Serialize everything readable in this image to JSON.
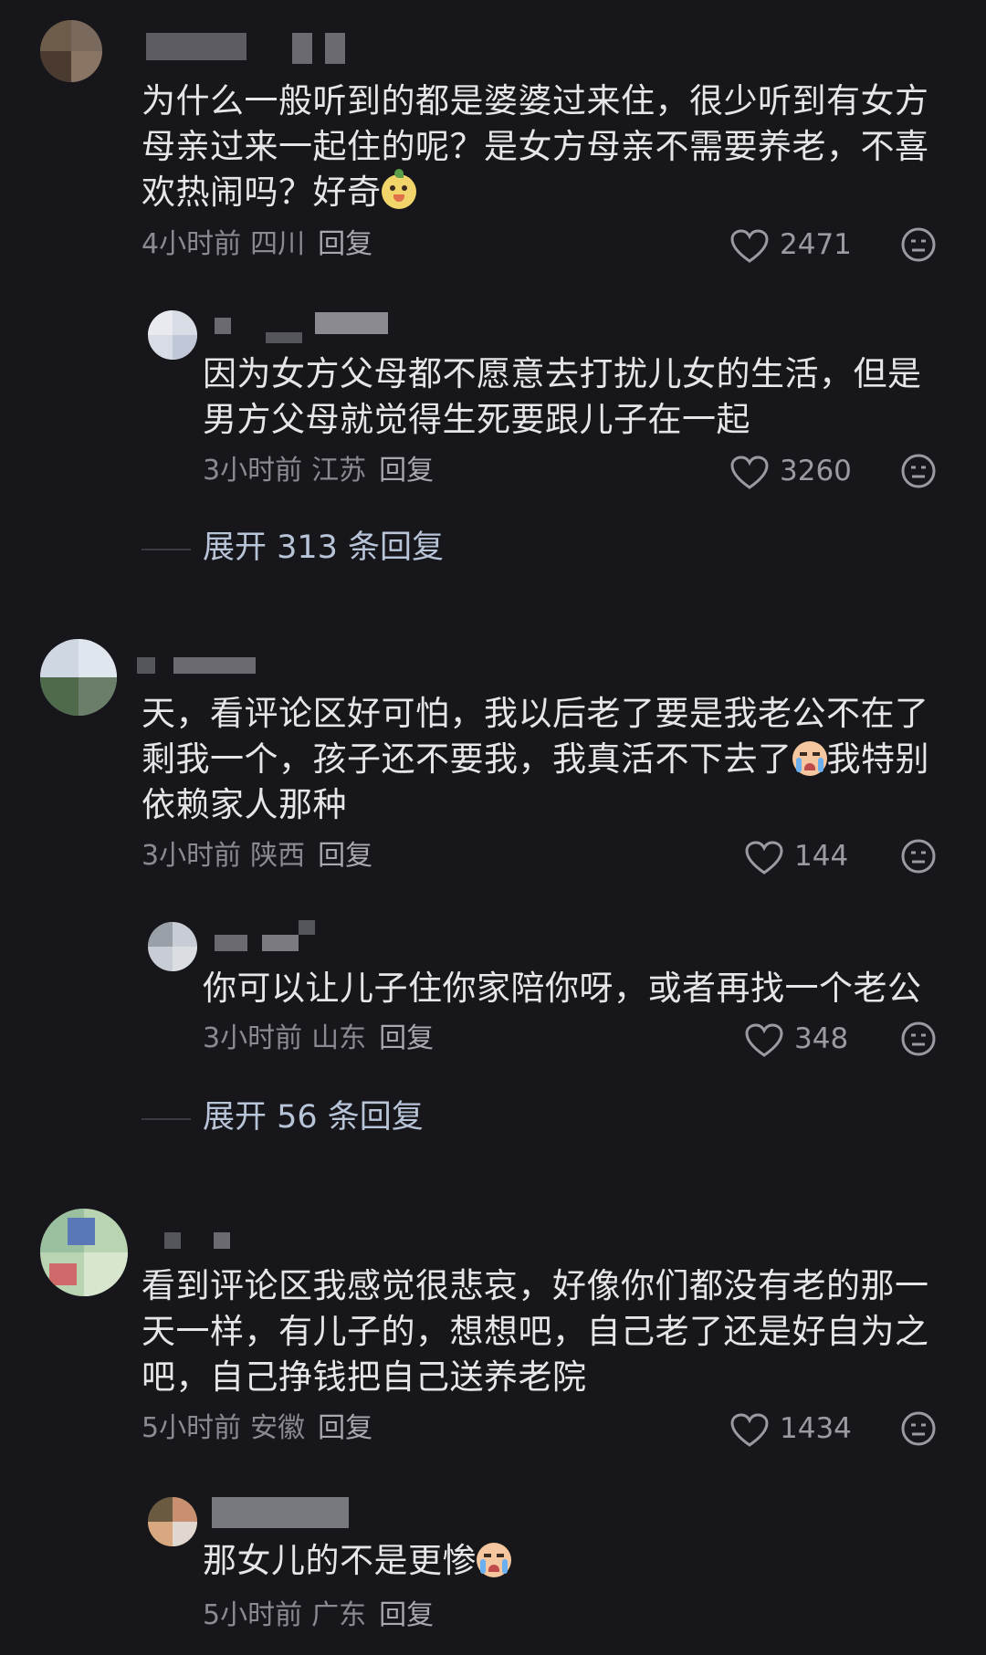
{
  "comments": [
    {
      "text": "为什么一般听到的都是婆婆过来住，很少听到有女方母亲过来一起住的呢？是女方母亲不需要养老，不喜欢热闹吗？好奇",
      "emoji": "cute-face-emoji",
      "time": "4小时前",
      "location": "四川",
      "reply_label": "回复",
      "likes": "2471",
      "reply": {
        "text": "因为女方父母都不愿意去打扰儿女的生活，但是男方父母就觉得生死要跟儿子在一起",
        "time": "3小时前",
        "location": "江苏",
        "reply_label": "回复",
        "likes": "3260"
      },
      "expand_label": "展开 313 条回复"
    },
    {
      "text": "天，看评论区好可怕，我以后老了要是我老公不在了剩我一个，孩子还不要我，我真活不下去了",
      "emoji": "crying-face-emoji",
      "text_after": "我特别依赖家人那种",
      "time": "3小时前",
      "location": "陕西",
      "reply_label": "回复",
      "likes": "144",
      "reply": {
        "text": "你可以让儿子住你家陪你呀，或者再找一个老公",
        "time": "3小时前",
        "location": "山东",
        "reply_label": "回复",
        "likes": "348"
      },
      "expand_label": "展开 56 条回复"
    },
    {
      "text": "看到评论区我感觉很悲哀，好像你们都没有老的那一天一样，有儿子的，想想吧，自己老了还是好自为之吧，自己挣钱把自己送养老院",
      "time": "5小时前",
      "location": "安徽",
      "reply_label": "回复",
      "likes": "1434",
      "reply": {
        "text": "那女儿的不是更惨",
        "emoji": "crying-face-emoji",
        "time": "5小时前",
        "location": "广东",
        "reply_label": "回复"
      }
    }
  ],
  "colors": {
    "background": "#17171b",
    "text": "#e6e6ea",
    "meta": "#8a8a92",
    "expand": "#b8c4d8"
  }
}
